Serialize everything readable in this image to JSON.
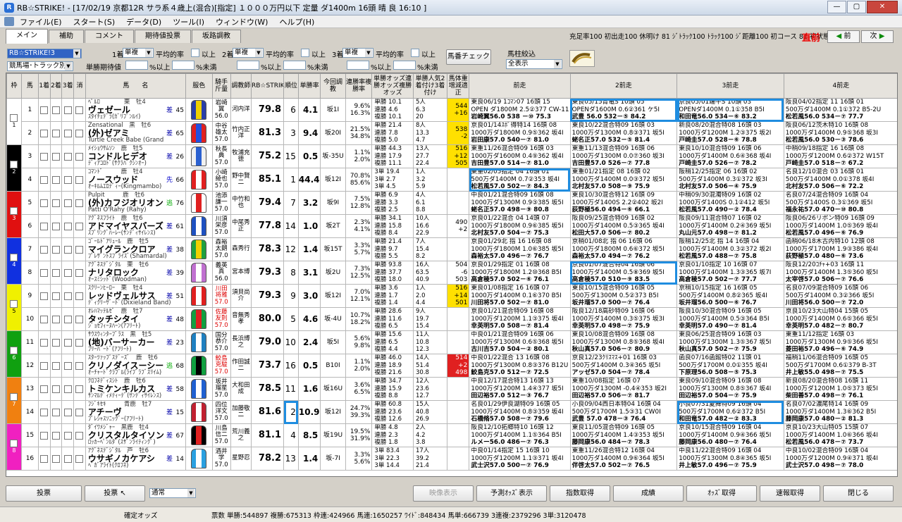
{
  "window": {
    "title": "RB☆STRIKE! - [17/02/19 京都12R サラ系４歳上(混合)[指定] １０００万円以下 定量 ダ1400m 16頭 晴 良 16:10 ]"
  },
  "menu": [
    "ファイル(E)",
    "スタート(S)",
    "データ(D)",
    "ツール(I)",
    "ウィンドウ(W)",
    "ヘルプ(H)"
  ],
  "tabs": [
    "メイン",
    "補助",
    "コメント",
    "期待値投票",
    "坂路調教"
  ],
  "status_text": "充足率100 初出走100 休明け 81 ｼﾞﾄﾗｯｸ100 ﾄﾗｯｸ100 ｼﾞ距離100 初コース 81 初状態100",
  "direct_label": "直前",
  "prev_label": "前",
  "next_label": "次",
  "filters": {
    "mode_combo": "RB☆STRIKE!3",
    "track_combo": "競馬場･トラック別",
    "rank1": "1着",
    "rank2": "2着",
    "rank3": "3着",
    "bet1": "単複",
    "bet2": "単複",
    "bet3": "単複",
    "avg": "平均的率",
    "above": "以上",
    "expect_label": "単勝期待値",
    "pct_above": "%以上",
    "pct_below": "%未満",
    "horse_check_button": "馬番チェック",
    "filter_label": "馬柱絞込",
    "filter_combo": "全表示"
  },
  "headers": {
    "waku": "枠",
    "uma": "馬",
    "c1": "1着",
    "c2": "2着",
    "c3": "3着",
    "kesu": "消",
    "name": "馬　　名",
    "fuku": "服色",
    "rider": "騎手斤量",
    "trainer": "調教師",
    "rb": "RB☆STRIKE!3",
    "order": "順位",
    "winrate": "単勝率",
    "train": "今回調教",
    "renpai": "連勝率複勝率",
    "odds": "単勝オッズ連勝オッズ複勝オッズ",
    "popular": "単勝人気2着付け3着付け",
    "weight": "馬体重増減適正",
    "p1": "前走",
    "p2": "2前走",
    "p3": "3前走",
    "p4": "4前走"
  },
  "horses": [
    {
      "waku": "1",
      "uma": "1",
      "name1": "ﾍﾟﾙﾛ　　　　栗　牡4",
      "name2": "ヴェゼール",
      "name3": "ｽﾀｲﾁｪﾃﾞﾗ(ｶﾞﾘﾌﾞﾝﾙｲ)",
      "mark": "差",
      "num": "45",
      "rider": "岩崎翼",
      "kin": "56.0",
      "trainer": "河内洋",
      "rb": "79.8",
      "order": "6",
      "win": "4.1",
      "train": "坂1I",
      "r1": "9.6%",
      "r2": "16.3%",
      "o1": "単勝 10.1",
      "o2": "連勝 4.6",
      "o3": "複勝 10.1",
      "pop": "5人",
      "pop2": "6.3",
      "pop3": "20",
      "w1": "544",
      "w2": "+16",
      "w3": "",
      "p1a": "東良06/19 1ｺﾏﾝ07 16頭 15",
      "p1b": "OPEN ダ1800M 2.5②377 CW-11",
      "p1c": "岩崎翼56.0 538 －⑩ 75.3",
      "p2a": "東良05/15青竜S 10頭 05",
      "p2b": "OPENダ1600M 0.6②361 ケ5I",
      "p2c": "武豊 56.0 532－⑤ 84.2",
      "p3a": "京良05/01端午S 10頭 03",
      "p3b": "OPENダ1400M 0.1①358 B5I",
      "p3c": "和田竜56.0 534－⑥ 83.2",
      "p4a": "阪良04/02指定 11 16頭 01",
      "p4b": "500万ダ1400M 0.1①372 B5-2U",
      "p4c": "松若風56.0 534－⑦ 77.7"
    },
    {
      "waku": "1",
      "uma": "2",
      "name1": "Zensational　黒　牡6",
      "name2": "(外)ゼアミ",
      "name3": "Turtle Creek Babe (Grand",
      "mark": "差",
      "num": "65",
      "rider": "中谷雄太",
      "kin": "57.0",
      "trainer": "竹内正洋",
      "rb": "81.3",
      "order": "3",
      "win": "9.4",
      "train": "坂20I",
      "r1": "21.5%",
      "r2": "34.8%",
      "o1": "単勝 21.4",
      "o2": "連勝 7.8",
      "o3": "複勝 5.0",
      "pop": "8人",
      "pop2": "13.3",
      "pop3": "4.7",
      "w1": "538",
      "w2": "-2",
      "w3": "",
      "p1a": "京良01/14ｽﾎﾞ得特14 16頭 08",
      "p1b": "1000万ダ1800M 0.9⑤362 坂4I",
      "p1c": "岩田康57.0 540－⑦ 81.0",
      "p2a": "東良10/22混合特09 16頭 03",
      "p2b": "1000万ダ1300M 0.8③371 坂5I",
      "p2c": "蛯名正57.0 532－⑤ 81.4",
      "p3a": "新良08/20混合特08 16頭 03",
      "p3b": "1000万ダ1200M 1.2③375 坂2I",
      "p3c": "戸崎圭57.0 528－⑥ 78.8",
      "p4a": "阪良06/12茨木特10 16頭 08",
      "p4b": "1000万ダ1400M 0.9⑤368 坂3I",
      "p4c": "松若風56.0 530－③ 78.6"
    },
    {
      "waku": "2",
      "uma": "3",
      "name1": "ﾒｲｼｮｳｻﾑｿﾝ　鹿　牡5",
      "name2": "コンドルヒデオ",
      "name3": "ﾃﾞｨｱｺﾛﾄﾞ(ｻｸﾗﾊﾞｸｼﾝｵｰ)",
      "mark": "差",
      "num": "26",
      "rider": "秋長典",
      "kin": "57.0",
      "trainer": "牧浦充徳",
      "rb": "75.2",
      "order": "15",
      "win": "0.5",
      "train": "坂-35U",
      "r1": "1.1%",
      "r2": "2.0%",
      "o1": "単勝 44.3",
      "o2": "連勝 17.9",
      "o3": "複勝 11.1",
      "pop": "13人",
      "pop2": "27.7",
      "pop3": "22.4",
      "w1": "516",
      "w2": "+12",
      "w3": "505",
      "p1a": "東重11/26混合特09 16頭 03",
      "p1b": "1000万ダ1600M 0.4⑨362 坂4I",
      "p1c": "吉田豊57.0 514－⑦ 81.0",
      "p2a": "東重11/13混合特09 16頭 06",
      "p2b": "1000万ダ1300M 0.0⑦360 坂3I",
      "p2c": "吉田豊57.0 526－⑦ 77.8",
      "p3a": "東良10/10混合特09 16頭 06",
      "p3b": "1000万ダ1400M 0.6④368 坂4I",
      "p3c": "戸崎圭57.0 526－⑦ 78.2",
      "p4a": "中稍09/18指定 16 16頭 08",
      "p4b": "1000万ダ1200M 0.6②372 W15T",
      "p4c": "戸崎圭57.0 518－⑦ 67.2"
    },
    {
      "waku": "2",
      "uma": "4",
      "name1": "ｺﾏﾝﾄﾞ　　　鹿　牡4",
      "name2": "ノースウッド",
      "name3": "ｵｰｷﾙﾑｴﾛﾃﾞｨｰ(Kingmambo)",
      "mark": "先",
      "num": "66",
      "rider": "小崎綾也",
      "kin": "57.0",
      "trainer": "野中賢二",
      "rb": "85.1",
      "order": "1",
      "win": "44.4",
      "train": "坂12I",
      "r1": "70.8%",
      "r2": "85.6%",
      "o1": "3単 19.4",
      "o2": "3単 2.7",
      "o3": "3単 4.5",
      "pop": "1人",
      "pop2": "3.2",
      "pop3": "5.9",
      "w1": "",
      "w2": "",
      "w3": "",
      "p1a": "東重02/05指定 04 16頭 01",
      "p1b": "500万ダ1400M 0.7②353 坂4I",
      "p1c": "松若風57.0 502－⑦ 84.3",
      "p2a": "東重01/21指定 08 16頭 02",
      "p2b": "1000万ダ1400M 0.0③372 坂5I",
      "p2c": "北村友57.0 508－⑨ 75.9",
      "p3a": "阪稍12/25指定 06 16頭 02",
      "p3b": "500万ダ1400M 0.3①372 坂3I",
      "p3c": "北村友57.0 506－④ 75.9",
      "p4a": "名良12/10混合 03 16頭 01",
      "p4b": "500万ダ1400M 0.0①378 坂4I",
      "p4c": "北村友57.0 506－⑥ 72.2"
    },
    {
      "waku": "3",
      "uma": "5",
      "name1": "Pulpit　　　鹿　牡6",
      "name2": "(外)カフジオリオン",
      "name3": "Patti O'Rahy (Rahy)",
      "mark": "逃",
      "num": "76",
      "rider": "池添謙一",
      "kin": "57.0",
      "trainer": "中竹和也",
      "rb": "79.4",
      "order": "7",
      "win": "3.2",
      "train": "坂9I",
      "r1": "7.5%",
      "r2": "12.8%",
      "o1": "単勝 6.9",
      "o2": "連勝 3.3",
      "o3": "複勝 2.5",
      "pop": "4人",
      "pop2": "6.1",
      "pop3": "8.8",
      "w1": "",
      "w2": "",
      "w3": "",
      "p1a": "中良01/21混合特09 16頭 08",
      "p1b": "1000万ダ1300M 0.9③385 坂5I",
      "p1c": "蛯名正57.0 498－⑨ 80.8",
      "p2a": "東良10/30混合特12 16頭 09",
      "p2b": "1000万ダ1400S 2.2②402 坂2I",
      "p2c": "荻野極56.0 494－⑥ 66.1",
      "p3a": "中稍09/30混濁特09 16頭 02",
      "p3b": "1000万ダ1400S 0.1②412 坂5I",
      "p3c": "松若風57.0 490－② 78.4",
      "p4a": "名良07/24混合特09 16頭 04",
      "p4b": "500万ダ1400S 0.3①369 坂5I",
      "p4c": "福永祐57.0 470－⑩ 80.8"
    },
    {
      "waku": "3",
      "uma": "6",
      "name1": "ｱｸﾞﾈｽﾌﾗｲﾄ　鹿　牡6",
      "name2": "アドマイヤスバーズ",
      "name3": "ｽﾌﾟﾘﾝｸﾞﾊｰﾚｰ(ｻﾝﾃﾞｨｻｲﾚﾝｽ)",
      "mark": "差",
      "num": "61",
      "rider": "川須栄彦",
      "kin": "57.0",
      "trainer": "中尾秀正",
      "rb": "77.8",
      "order": "14",
      "win": "1.0",
      "train": "坂2T",
      "r1": "2.3%",
      "r2": "4.1%",
      "o1": "単勝 34.1",
      "o2": "連勝 15.8",
      "o3": "複勝 8.4",
      "pop": "10人",
      "pop2": "16.6",
      "pop3": "22.9",
      "w1": "490",
      "w2": "+2",
      "w3": "",
      "p1a": "京良01/22混合 04 14頭 07",
      "p1b": "1000万ダ1800M 0.9⑥385 坂5I",
      "p1c": "北村友57.0 504－⑦ 75.3",
      "p2a": "阪良09/25混合特09 16頭 02",
      "p2b": "1000万ダ1400M 0.5③365 坂4I",
      "p2c": "松田大57.0 506－⑦ 80.2",
      "p3a": "阪良09/11混合特07 16頭 02",
      "p3b": "1000万ダ1400M 0.2④369 坂5I",
      "p3c": "丸山元57.0 498－⑦ 81.2",
      "p4a": "阪良06/26リボン特09 16頭 09",
      "p4b": "1000万ダ1400M 1.0⑤369 坂4I",
      "p4c": "松若風57.0 496－⑥ 76.9"
    },
    {
      "waku": "4",
      "uma": "7",
      "name1": "ｺﾞｰﾙﾄﾞｱﾘｭｰﾙ　鹿　牡5",
      "name2": "マイグランクロア",
      "name3": "ﾌﾟﾚｻﾞﾝﾄｽﾌﾞﾗｲｽﾞ(Shamardal)",
      "mark": "差",
      "num": "38",
      "rider": "森裕太朗",
      "kin": "57.0",
      "trainer": "森秀行",
      "rb": "78.3",
      "order": "12",
      "win": "1.4",
      "train": "坂15T",
      "r1": "3.3%",
      "r2": "5.7%",
      "o1": "単勝 21.4",
      "o2": "連勝 9.7",
      "o3": "複勝 5.5",
      "pop": "7人",
      "pop2": "15.4",
      "pop3": "8.2",
      "w1": "",
      "w2": "",
      "w3": "",
      "p1a": "京良01/29北 指 16 16頭 08",
      "p1b": "1000万ダ1800M 1.0⑥385 坂5I",
      "p1c": "森裕太57.0 496－⑦ 76.7",
      "p2a": "京稍01/08北 指 06 16頭 06",
      "p2b": "1000万ダ1800M 0.6⑥372 坂5I",
      "p2c": "森裕太57.0 494－⑦ 76.2",
      "p3a": "阪稍12/25北 指 14 16頭 04",
      "p3b": "1000万ダ1400M 0.3②372 坂2I",
      "p3c": "松若風57.0 488－⑦ 75.8",
      "p4a": "函稍06/18木古内特10 12頭 08",
      "p4b": "1000万ダ1700M 1.9③386 坂4I",
      "p4c": "荻野極57.0 480－⑥ 73.6"
    },
    {
      "waku": "4",
      "uma": "8",
      "name1": "ｱｸﾞﾈｽﾃﾞｼﾞﾀﾙ　栗　牡6",
      "name2": "ナリタロック",
      "name3": "ｵｰｽﾐｼｯﾄﾞ(Woodman)",
      "mark": "差",
      "num": "39",
      "rider": "義英真",
      "kin": "56.0",
      "trainer": "宮本博",
      "rb": "79.3",
      "order": "8",
      "win": "3.1",
      "train": "坂2U",
      "r1": "7.3%",
      "r2": "12.5%",
      "o1": "単勝 93.8",
      "o2": "連勝 37.7",
      "o3": "複勝 18.0",
      "pop": "16人",
      "pop2": "63.5",
      "pop3": "40.9",
      "w1": "504",
      "w2": "-6",
      "w3": "503",
      "p1a": "京良01/29指定 01 16頭 08",
      "p1b": "1000万ダ1800M 1.2⑩368 B5I",
      "p1c": "高倉稜57.0 502－⑥ 76.1",
      "p2a": "京良01/07混合特04 16頭 06",
      "p2b": "1000万ダ1400M 0.5⑧369 坂5I",
      "p2c": "高倉稜57.0 510－⑨ 83.5",
      "p3a": "京良01/10指定 10 16頭 07",
      "p3b": "1000万ダ1400M 1.3③365 坂7I",
      "p3c": "高倉稜57.0 502－⑦ 77.7",
      "p4a": "阪良12/20ｺﾁｬ+03 16頭 11",
      "p4b": "1000万ダ1400M 1.3⑤360 坂5I",
      "p4c": "太宰啓57.0 506－⑦ 76.6"
    },
    {
      "waku": "5",
      "uma": "9",
      "name1": "ｽｸﾘｰﾝﾋｰﾛｰ　栗　牡4",
      "name2": "レッドヴェルサス",
      "name3": "ﾃﾞｨｸﾘｰｻﾞｰﾄﾞ(Dixieland Band)",
      "mark": "差",
      "num": "51",
      "rider": "川田将雅",
      "kin": "57.0",
      "trainer": "須貝尚介",
      "rb": "79.3",
      "order": "9",
      "win": "3.0",
      "train": "坂12I",
      "r1": "7.0%",
      "r2": "12.1%",
      "o1": "単勝 3.6",
      "o2": "連勝 1.7",
      "o3": "複勝 1.4",
      "pop": "1人",
      "pop2": "2.0",
      "pop3": "4.4",
      "w1": "516",
      "w2": "+14",
      "w3": "501",
      "p1a": "東良01/08指定 16 16頭 07",
      "p1b": "1000万ダ1400M 0.1⑥370 B5I",
      "p1c": "川田将57.0 502－⑦ 81.0",
      "p2a": "東良10/15混合特09 16頭 05",
      "p2b": "500万ダ1300M 0.5②373 B5I",
      "p2c": "坂井瑠57.0 500－⑦ 76.4",
      "p3a": "京稍10/15指定 16 16頭 05",
      "p3b": "500万ダ1400M 0.8②365 坂4I",
      "p3c": "坂井瑠56.0 500－⑥ 76.7",
      "p4a": "名良07/09混合特09 16頭 06",
      "p4b": "500万ダ1400M 0.3②366 坂5I",
      "p4c": "川田将56.0 500－⑦ 72.0"
    },
    {
      "waku": "5",
      "uma": "10",
      "name1": "ｵﾚﾊﾏｯﾃﾙｾﾞ　鹿　牡7",
      "name2": "タッチシタイ",
      "name3": "ｼﾞｮｾﾌｨｰﾇﾊｰﾝ(ｱﾌﾘｰﾄ)",
      "mark": "差",
      "num": "48",
      "rider": "佐藤友則",
      "kin": "57.0",
      "trainer": "音無秀孝",
      "rb": "80.0",
      "order": "5",
      "win": "4.6",
      "train": "坂-4U",
      "r1": "10.7%",
      "r2": "18.2%",
      "o1": "単勝 28.6",
      "o2": "連勝 11.6",
      "o3": "複勝 6.5",
      "pop": "9人",
      "pop2": "19.7",
      "pop3": "15.4",
      "w1": "",
      "w2": "",
      "w3": "",
      "p1a": "京良01/21混合特09 16頭 08",
      "p1b": "1000万ダ1200M 1.1③375 坂4I",
      "p1c": "幸英明57.0 508－⑦ 81.4",
      "p2a": "阪良12/18高砂特09 16頭 06",
      "p2b": "1000万ダ1400M 0.3⑤375 坂3I",
      "p2c": "幸英明57.0 498－⑦ 75.9",
      "p3a": "阪良10/30混合特09 16頭 05",
      "p3b": "1000万ダ1400M 0.5③364 B5I",
      "p3c": "幸英明57.0 490－⑦ 81.4",
      "p4a": "京良10/23大山特04 15頭 05",
      "p4b": "1000万ダ1400M 0.6⑤366 坂5I",
      "p4c": "幸英明57.0 482－⑦ 80.7"
    },
    {
      "waku": "6",
      "uma": "11",
      "name1": "ｻｳｽｳｨﾝﾀｰﾌﾞﾗｽ　黒　牡5",
      "name2": "(地)バーサーカー",
      "name3": "ﾌﾘｰﾊﾞｰﾄﾞ(ｱﾌﾘｰﾄ)",
      "mark": "差",
      "num": "23",
      "rider": "国分恭介",
      "kin": "57.0",
      "trainer": "長浜博之",
      "rb": "79.0",
      "order": "10",
      "win": "2.4",
      "train": "坂5I",
      "r1": "5.6%",
      "r2": "9.8%",
      "o1": "単勝 15.6",
      "o2": "連勝 6.5",
      "o3": "複勝 4.4",
      "pop": "11人",
      "pop2": "10.8",
      "pop3": "12.3",
      "w1": "",
      "w2": "",
      "w3": "",
      "p1a": "中良01/21混合特09 16頭 06",
      "p1b": "1000万ダ1300M 0.6⑤368 坂5I",
      "p1c": "古川吉57.0 504－② 80.1",
      "p2a": "東良10/08混合特09 16頭 08",
      "p2b": "1000万ダ1300M 0.8⑤368 坂4I",
      "p2c": "秋山真57.0 506－⑦ 80.9",
      "p3a": "東良06/25混合特09 16頭 03",
      "p3b": "1000万ダ1300M 1.3⑤367 坂5I",
      "p3c": "秋山真57.0 502－⑦ 75.9",
      "p4a": "東重11/12指定 16頭 03",
      "p4b": "1000万ダ1300M 0.9⑤366 坂5I",
      "p4c": "菱田裕57.0 496－⑥ 74.9"
    },
    {
      "waku": "6",
      "uma": "12",
      "name1": "ｽﾀｰﾂｧｯﾌﾟｽﾃﾞｰｽﾞ　鹿　牡6",
      "name2": "クリノダイスーシー",
      "name3": "ｵｰﾁｬｰﾄﾞｸﾗﾌﾞﾙ(ﾗｲﾌﾞﾗﾌﾞｽﾘｲﾑ)",
      "mark": "逃",
      "num": "68",
      "rider": "鮫島克駿",
      "kin": "57.0",
      "trainer": "作田誠二",
      "rb": "73.7",
      "order": "16",
      "win": "0.5",
      "train": "B10I",
      "r1": "1.1%",
      "r2": "2.0%",
      "o1": "単勝 46.0",
      "o2": "連勝 18.9",
      "o3": "複勝 21.6",
      "pop": "14人",
      "pop2": "51.4",
      "pop3": "30.8",
      "w1": "514",
      "w2": "+2",
      "w3": "498",
      "p1a": "中良01/22混合 13 16頭 08",
      "p1b": "1000万ダ1300M 0.8③376 B12U",
      "p1c": "鮫島克57.0 512－⑦ 72.5",
      "p2a": "京良12/23ｸﾘｽﾏｽ+01 16頭 03",
      "p2b": "500万ダ1400M 0.3④365 坂5I",
      "p2c": "アッゼ57.0 504－⑦ 78.4",
      "p3a": "函良07/16函館特02 11頭 01",
      "p3b": "500万ダ1700M 0.0①355 坂4I",
      "p3c": "下原理56.0 508－⑤ 75.3",
      "p4a": "福稍11/06混合特09 16頭 05",
      "p4b": "500万ダ1700M 0.6①379 B-3T",
      "p4c": "井上敏55.0 498－⑦ 75.5"
    },
    {
      "waku": "7",
      "uma": "13",
      "name1": "ｸﾛﾌﾈﾃﾞｨｽｼﾄ　鹿　牡6",
      "name2": "トミケンキルカス",
      "name3": "ｻﾝﾏﾙﾃﾞｨﾒﾃｨｰﾃﾞ(ｻﾝﾃﾞｨｻｲﾚﾝｽ)",
      "mark": "差",
      "num": "58",
      "rider": "坂井瑠星",
      "kin": "57.0",
      "trainer": "大和田成",
      "rb": "78.5",
      "order": "11",
      "win": "1.6",
      "train": "坂16U",
      "r1": "3.6%",
      "r2": "6.5%",
      "o1": "単勝 34.7",
      "o2": "連勝 15.9",
      "o3": "複勝 8.8",
      "pop": "12人",
      "pop2": "23.6",
      "pop3": "12.7",
      "w1": "",
      "w2": "",
      "w3": "",
      "p1a": "中良12/17混合特13 16頭 13",
      "p1b": "1000万ダ1200M 1.4④377 坂5I",
      "p1c": "田辺裕57.0 512－③ 76.7",
      "p2a": "東重10/08指定 16頭 07",
      "p2b": "1000万ダ1300M -0.4④353 坂2I",
      "p2c": "田辺裕57.0 506－⑦ 81.7",
      "p3a": "東良09/10混合特09 16頭 08",
      "p3b": "1000万ダ1300M 0.8⑤367 坂4I",
      "p3c": "田辺裕57.0 504－⑦ 75.9",
      "p4a": "新良08/20混合特08 16頭 11",
      "p4b": "1000万ダ1200M 1.0⑤373 坂5I",
      "p4c": "柴田善57.0 498－⑦ 76.1"
    },
    {
      "waku": "7",
      "uma": "14",
      "name1": "ﾌｼﾞｷｾｷ　　　青鹿　牡7",
      "name2": "アチーヴ",
      "name3": "ﾌﾟﾚｼｬｽｿﾆｯｸﾞｰ(ｱﾌﾘｰﾄ)",
      "mark": "差",
      "num": "15",
      "rider": "四位洋文",
      "kin": "57.0",
      "trainer": "加藤敬二",
      "rb": "81.6",
      "order": "2",
      "win": "10.9",
      "train": "坂12I",
      "r1": "24.7%",
      "r2": "39.3%",
      "o1": "単勝 60.8",
      "o2": "連勝 23.6",
      "o3": "複勝 12.6",
      "pop": "15人",
      "pop2": "40.8",
      "pop3": "26.9",
      "w1": "",
      "w2": "",
      "w3": "",
      "p1a": "名良01/29伊良湖特09 16頭 05",
      "p1b": "1000万ダ1400M 0.8③359 坂4I",
      "p1c": "石橋脩57.0 508－⑦ 79.6",
      "p2a": "小良09/04西日本特04 16頭 04",
      "p2b": "500万ダ1700M 1.5③31 CW0I",
      "p2c": "武豊 57.0 478－③ 76.4",
      "p3a": "小良07/31夏舞特09 16頭 04",
      "p3b": "500万ダ1700M 0.6②372 B5I",
      "p3c": "和田竜57.0 482－② 83.3",
      "p4a": "名良07/02濃尾特14 16頭 09",
      "p4b": "1000万ダ1400M 1.3⑥362 B5I",
      "p4c": "藤岡康57.0 480－② 81.3"
    },
    {
      "waku": "8",
      "uma": "15",
      "name1": "ﾀﾞｲﾜﾒｼﾞｬｰ　黒鹿　牡4",
      "name2": "クリスタルタイソン",
      "name3": "ﾛｯｶｰﾍﾟﾝﾙﾀﾞ(ｽｻﾞﾝﾗｲﾃｨﾝｸﾞ)",
      "mark": "差",
      "num": "67",
      "rider": "川島信二",
      "kin": "57.0",
      "trainer": "荒川義之",
      "rb": "81.1",
      "order": "4",
      "win": "8.5",
      "train": "坂19U",
      "r1": "19.5%",
      "r2": "31.9%",
      "o1": "単勝 4.8",
      "o2": "連勝 2.3",
      "o3": "複勝 1.8",
      "pop": "2人",
      "pop2": "4.2",
      "pop3": "3.8",
      "w1": "",
      "w2": "",
      "w3": "",
      "p1a": "阪良12/10拓郷特10 16頭 12",
      "p1b": "1000万ダ1400M 1.1⑤364 B5I",
      "p1c": "ルメー56.0 486－⑦ 76.3",
      "p2a": "東良11/05混合特09 16頭 05",
      "p2b": "1000万ダ1400M 1.4③353 坂5I",
      "p2c": "藤岡康56.0 484－⑦ 78.3",
      "p3a": "京良10/15混合特09 16頭 04",
      "p3b": "1000万ダ1400M 0.9④366 坂5I",
      "p3c": "藤岡康56.0 480－⑦ 76.4",
      "p4a": "京良10/23大山特05 15頭 07",
      "p4b": "1000万ダ1400M 1.0⑥366 坂4I",
      "p4c": "松若風56.0 478－⑦ 73.7"
    },
    {
      "waku": "8",
      "uma": "16",
      "name1": "ｱｸﾞﾈｽﾃﾞｼﾞﾀﾙ　芦　牡6",
      "name2": "ウサギノカケアシ",
      "name3": "ﾍﾞｶﾞｱﾗｲﾄ(ｸﾛﾌﾈ)",
      "mark": "差",
      "num": "14",
      "rider": "酒井学",
      "kin": "57.0",
      "trainer": "星野忍",
      "rb": "78.2",
      "order": "13",
      "win": "1.4",
      "train": "坂-7I",
      "r1": "3.3%",
      "r2": "5.6%",
      "o1": "3単 83.4",
      "o2": "3単 22.3",
      "o3": "3単 14.4",
      "pop": "17人",
      "pop2": "39.2",
      "pop3": "21.4",
      "w1": "",
      "w2": "",
      "w3": "",
      "p1a": "中良01/14指定 15 16頭 10",
      "p1b": "1000万ダ1200M 1.1③371 坂4I",
      "p1c": "武士沢57.0 500－⑦ 76.9",
      "p2a": "東重11/26混合特12 16頭 04",
      "p2b": "1000万ダ1400M 0.9⑥364 坂5I",
      "p2c": "伴啓太57.0 502－⑦ 76.5",
      "p3a": "中良11/22混合特09 16頭 04",
      "p3b": "1000万ダ1300M 0.8④365 坂5I",
      "p3c": "井上敏57.0 496－⑦ 75.9",
      "p4a": "中良10/02混合特09 16頭 04",
      "p4b": "1000万ダ1200M 0.9④371 坂4I",
      "p4c": "武士沢57.0 498－⑦ 78.0"
    }
  ],
  "bottom_buttons": {
    "vote": "投票",
    "vote2": "投票",
    "vote_mode": "通常",
    "movie": "映像表示",
    "predict": "予測ｵｯｽﾞ表示",
    "index": "指数取得",
    "result": "成績",
    "odds": "ｵｯｽﾞ取得",
    "fetch": "速報取得",
    "close": "閉じる"
  },
  "statusbar": {
    "label": "確定オッズ",
    "votes": "票数 単勝:544897 複勝:675313 枠連:424966 馬連:1650257 ﾜｲﾄﾞ:848434 馬単:666739 3連複:2379296 3単:3120478"
  },
  "colors": {
    "waku1": "#ffffff",
    "waku2": "#000000",
    "waku3": "#e01010",
    "waku4": "#1030e0",
    "waku5": "#f0f000",
    "waku6": "#10a010",
    "waku7": "#f08010",
    "waku8": "#f020c0",
    "highlight": "#1f8de0"
  },
  "highlights": {
    "p2_row1": true,
    "p3_row1": true,
    "p1_row4": true,
    "p2_row8": true,
    "order_row14": true,
    "p3_row14": true
  }
}
